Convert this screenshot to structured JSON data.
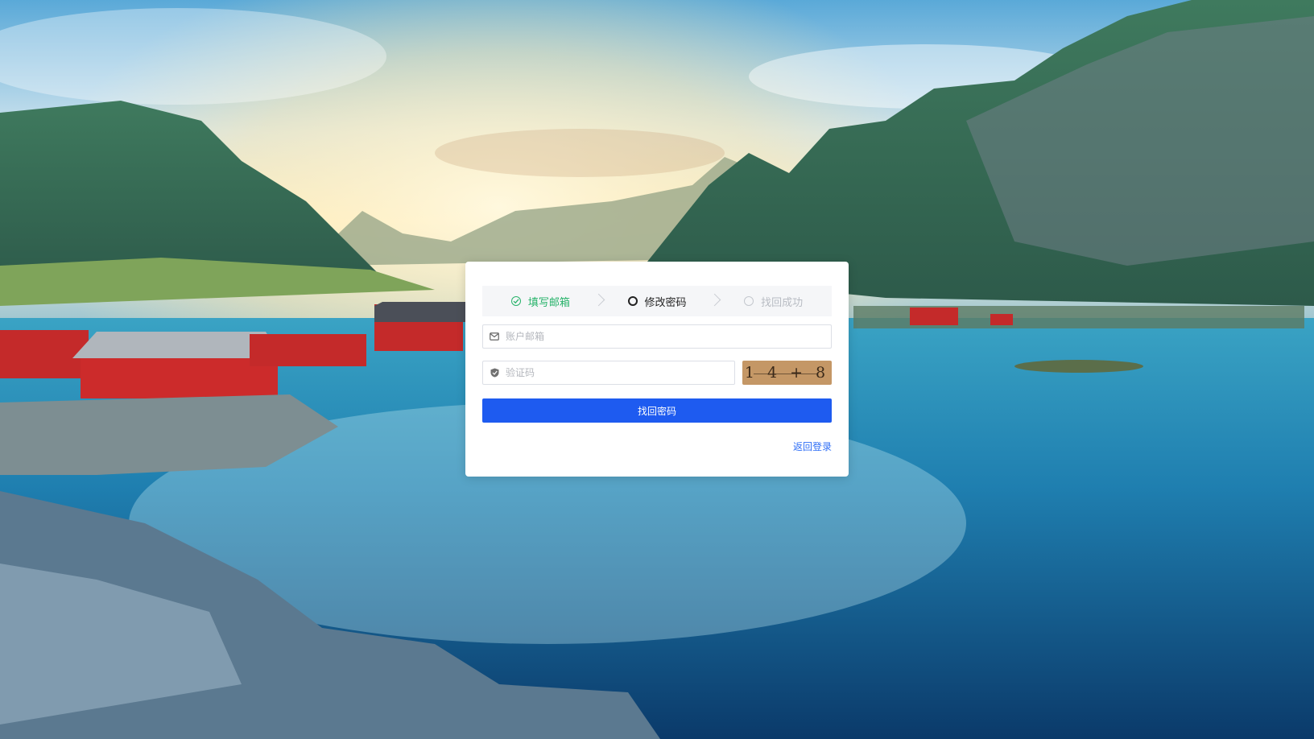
{
  "steps": [
    {
      "label": "填写邮箱",
      "state": "done"
    },
    {
      "label": "修改密码",
      "state": "active"
    },
    {
      "label": "找回成功",
      "state": "todo"
    }
  ],
  "email_field": {
    "placeholder": "账户邮箱",
    "value": "",
    "icon": "mail-icon"
  },
  "captcha_field": {
    "placeholder": "验证码",
    "value": "",
    "icon": "shield-icon"
  },
  "captcha_image": {
    "text": "1 4 + 8"
  },
  "submit_button": {
    "label": "找回密码"
  },
  "back_link": {
    "label": "返回登录"
  },
  "colors": {
    "primary": "#1e5bf0",
    "success": "#27b36a",
    "link": "#2d6df6",
    "captcha_bg": "#c49766"
  }
}
